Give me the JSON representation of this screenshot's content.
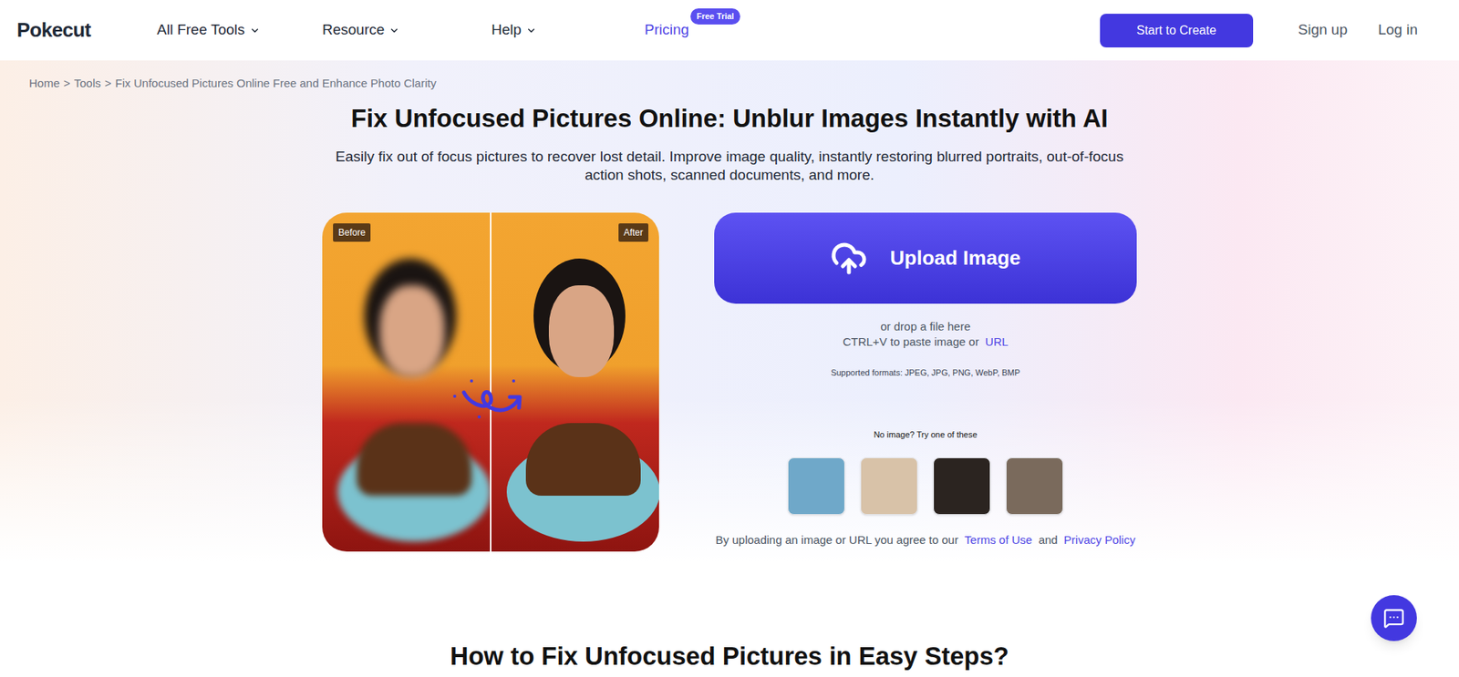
{
  "header": {
    "logo": "Pokecut",
    "nav": [
      {
        "label": "All Free Tools",
        "dropdown": true
      },
      {
        "label": "Resource",
        "dropdown": true
      },
      {
        "label": "Help",
        "dropdown": true
      },
      {
        "label": "Pricing",
        "dropdown": false,
        "badge": "Free Trial"
      }
    ],
    "cta": "Start to Create",
    "signup": "Sign up",
    "login": "Log in"
  },
  "breadcrumb": {
    "separator": ">",
    "items": [
      "Home",
      "Tools",
      "Fix Unfocused Pictures Online Free and Enhance Photo Clarity"
    ]
  },
  "hero": {
    "title": "Fix Unfocused Pictures Online: Unblur Images Instantly with AI",
    "subtitle": "Easily fix out of focus pictures to recover lost detail. Improve image quality, instantly restoring blurred portraits, out-of-focus action shots, scanned documents, and more.",
    "comparison": {
      "before": "Before",
      "after": "After"
    }
  },
  "upload": {
    "button": "Upload Image",
    "drop": "or drop a file here",
    "paste": "CTRL+V to paste image or",
    "url": "URL",
    "formats": "Supported formats: JPEG, JPG, PNG, WebP, BMP",
    "samples_label": "No image? Try one of these",
    "samples": [
      {
        "color": "#6fa8c9"
      },
      {
        "color": "#d8c2a8"
      },
      {
        "color": "#2b2420"
      },
      {
        "color": "#7a6a5c"
      }
    ],
    "terms_prefix": "By uploading an image or URL you agree to our",
    "terms": "Terms of Use",
    "and": "and",
    "privacy": "Privacy Policy"
  },
  "section_heading": "How to Fix Unfocused Pictures in Easy Steps?"
}
